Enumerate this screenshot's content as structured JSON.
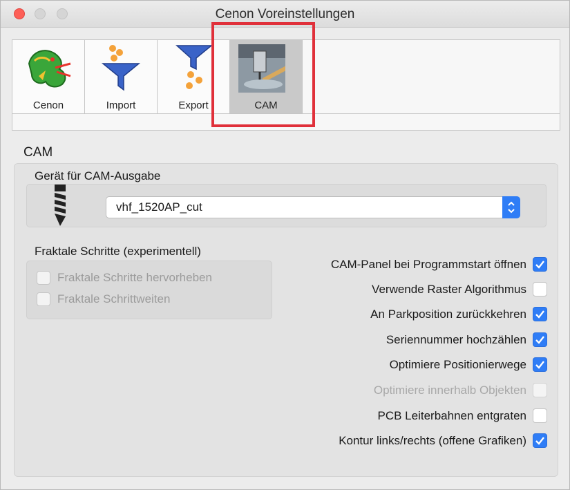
{
  "window": {
    "title": "Cenon Voreinstellungen"
  },
  "toolbar": {
    "items": [
      {
        "label": "Cenon",
        "icon": "dragon-icon"
      },
      {
        "label": "Import",
        "icon": "import-funnel-icon"
      },
      {
        "label": "Export",
        "icon": "export-funnel-icon"
      },
      {
        "label": "CAM",
        "icon": "cam-machine-icon",
        "selected": true
      }
    ]
  },
  "cam": {
    "section_title": "CAM",
    "device_label": "Gerät für CAM-Ausgabe",
    "device_value": "vhf_1520AP_cut",
    "fractal_label": "Fraktale Schritte (experimentell)",
    "fractal_options": [
      {
        "label": "Fraktale Schritte hervorheben",
        "checked": false,
        "enabled": false
      },
      {
        "label": "Fraktale Schrittweiten",
        "checked": false,
        "enabled": false
      }
    ],
    "options": [
      {
        "label": "CAM-Panel bei Programmstart öffnen",
        "checked": true,
        "enabled": true
      },
      {
        "label": "Verwende Raster Algorithmus",
        "checked": false,
        "enabled": true
      },
      {
        "label": "An Parkposition zurückkehren",
        "checked": true,
        "enabled": true
      },
      {
        "label": "Seriennummer hochzählen",
        "checked": true,
        "enabled": true
      },
      {
        "label": "Optimiere Positionierwege",
        "checked": true,
        "enabled": true
      },
      {
        "label": "Optimiere innerhalb Objekten",
        "checked": false,
        "enabled": false
      },
      {
        "label": "PCB Leiterbahnen entgraten",
        "checked": false,
        "enabled": true
      },
      {
        "label": "Kontur links/rechts (offene Grafiken)",
        "checked": true,
        "enabled": true
      }
    ]
  },
  "colors": {
    "accent": "#2f7df6",
    "highlight": "#e0303a"
  }
}
